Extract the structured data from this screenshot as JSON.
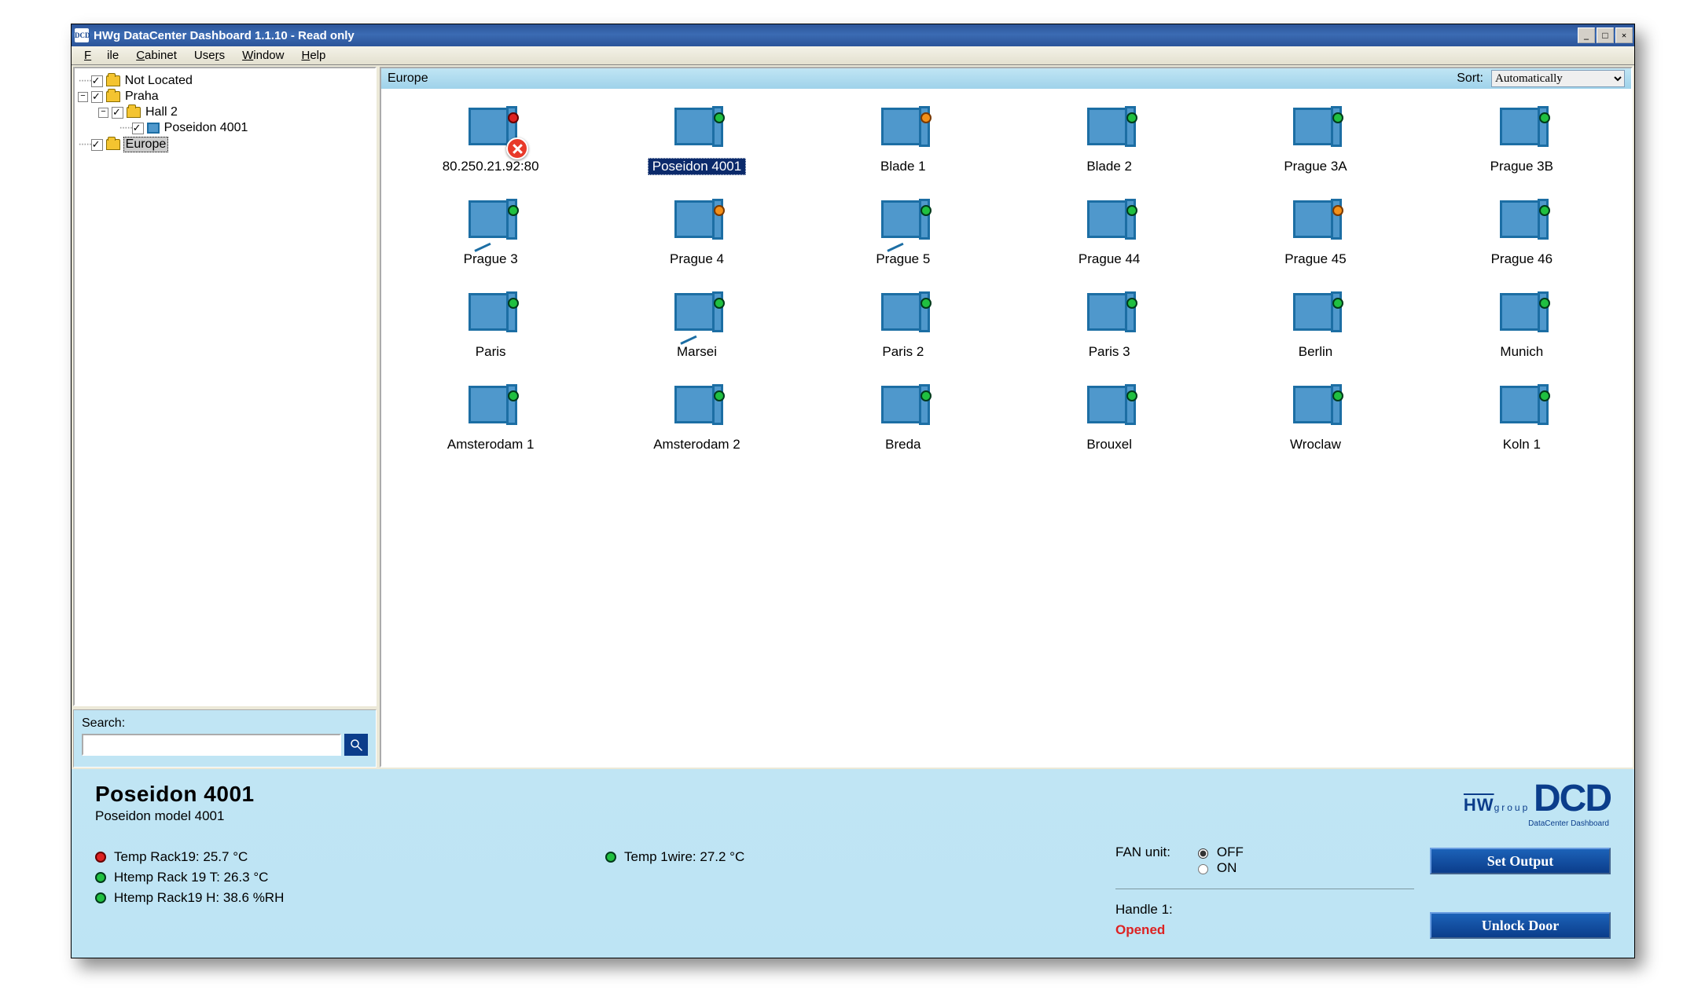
{
  "window": {
    "icon_text": "DCD",
    "title": "HWg DataCenter Dashboard 1.1.10 - Read only",
    "btn_min": "_",
    "btn_max": "□",
    "btn_close": "×"
  },
  "menu": {
    "file": "File",
    "cabinet": "Cabinet",
    "users": "Users",
    "window": "Window",
    "help": "Help"
  },
  "tree": {
    "not_located": "Not Located",
    "praha": "Praha",
    "hall2": "Hall 2",
    "poseidon": "Poseidon 4001",
    "europe": "Europe"
  },
  "search": {
    "label": "Search:",
    "value": ""
  },
  "location_bar": {
    "path": "Europe",
    "sort_label": "Sort:",
    "sort_value": "Automatically"
  },
  "cabinets": [
    {
      "label": "80.250.21.92:80",
      "led": "red",
      "error": true
    },
    {
      "label": "Poseidon 4001",
      "led": "green",
      "selected": true,
      "shadow": true
    },
    {
      "label": "Blade 1",
      "led": "orange"
    },
    {
      "label": "Blade 2",
      "led": "green"
    },
    {
      "label": "Prague 3A",
      "led": "green"
    },
    {
      "label": "Prague 3B",
      "led": "green"
    },
    {
      "label": "Prague 3",
      "led": "green",
      "door_open": true
    },
    {
      "label": "Prague 4",
      "led": "orange"
    },
    {
      "label": "Prague 5",
      "led": "green",
      "door_open": true
    },
    {
      "label": "Prague 44",
      "led": "green"
    },
    {
      "label": "Prague 45",
      "led": "orange"
    },
    {
      "label": "Prague 46",
      "led": "green"
    },
    {
      "label": "Paris",
      "led": "green"
    },
    {
      "label": "Marsei",
      "led": "green",
      "door_open": true
    },
    {
      "label": "Paris 2",
      "led": "green"
    },
    {
      "label": "Paris 3",
      "led": "green"
    },
    {
      "label": "Berlin",
      "led": "green"
    },
    {
      "label": "Munich",
      "led": "green"
    },
    {
      "label": "Amsterodam 1",
      "led": "green"
    },
    {
      "label": "Amsterodam 2",
      "led": "green"
    },
    {
      "label": "Breda",
      "led": "green"
    },
    {
      "label": "Brouxel",
      "led": "green"
    },
    {
      "label": "Wroclaw",
      "led": "green"
    },
    {
      "label": "Koln 1",
      "led": "green"
    }
  ],
  "detail": {
    "title": "Poseidon 4001",
    "subtitle": "Poseidon model 4001",
    "sensors": {
      "temp_rack19": "Temp Rack19: 25.7 °C",
      "htemp_rack19t": "Htemp Rack 19 T: 26.3 °C",
      "htemp_rack19h": "Htemp Rack19 H: 38.6 %RH",
      "temp_1wire": "Temp 1wire: 27.2 °C"
    },
    "fan_label": "FAN unit:",
    "fan_off": "OFF",
    "fan_on": "ON",
    "handle_label": "Handle 1:",
    "handle_state": "Opened",
    "btn_set": "Set Output",
    "btn_unlock": "Unlock Door"
  },
  "brand": {
    "hw": "HW",
    "group": "group",
    "dcd": "DCD",
    "sub": "DataCenter Dashboard"
  }
}
